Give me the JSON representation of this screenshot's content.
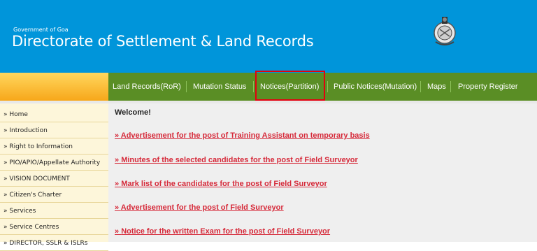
{
  "header": {
    "government": "Government of Goa",
    "title": "Directorate of Settlement & Land Records"
  },
  "nav": {
    "items": [
      "Land Records(RoR)",
      "Mutation Status",
      "Notices(Partition)",
      "Public Notices(Mutation)",
      "Maps",
      "Property Register"
    ],
    "highlighted": "Notices(Partition)"
  },
  "sidebar": {
    "items": [
      "Home",
      "Introduction",
      "Right to Information",
      "PIO/APIO/Appellate Authority",
      "VISION DOCUMENT",
      "Citizen's Charter",
      "Services",
      "Service Centres",
      "DIRECTOR, SSLR & ISLRs"
    ]
  },
  "content": {
    "welcome": "Welcome!",
    "notices": [
      "Advertisement for the post of Training Assistant on temporary basis",
      "Minutes of the selected candidates for the post of Field Surveyor",
      "Mark list of the candidates for the post of Field Surveyor",
      "Advertisement for the post of Field Surveyor",
      "Notice for the written Exam for the post of Field Surveyor"
    ]
  },
  "colors": {
    "header_bg": "#0095da",
    "nav_bg": "#5a8e25",
    "link": "#d62a3a",
    "highlight": "#e3000f"
  }
}
